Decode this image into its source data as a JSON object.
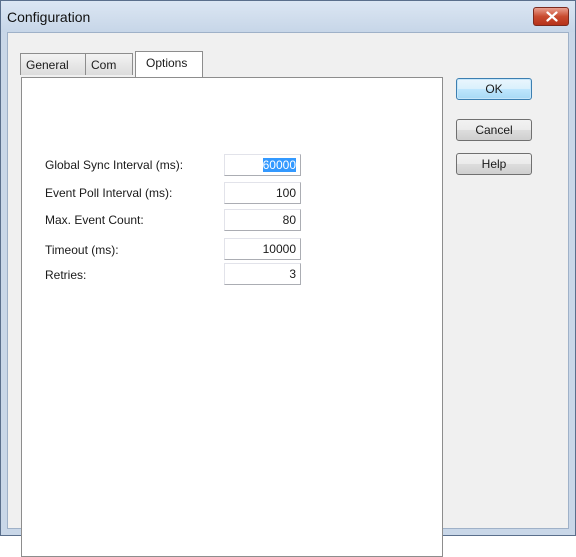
{
  "window": {
    "title": "Configuration"
  },
  "tabs": [
    {
      "label": "General"
    },
    {
      "label": "Com"
    },
    {
      "label": "Options"
    }
  ],
  "active_tab": "Options",
  "fields": [
    {
      "label": "Global Sync Interval (ms):",
      "value": "60000"
    },
    {
      "label": "Event Poll Interval (ms):",
      "value": "100"
    },
    {
      "label": "Max. Event Count:",
      "value": "80"
    },
    {
      "label": "Timeout (ms):",
      "value": "10000"
    },
    {
      "label": "Retries:",
      "value": "3"
    }
  ],
  "buttons": {
    "ok": "OK",
    "cancel": "Cancel",
    "help": "Help"
  },
  "icons": {
    "close": "close-icon"
  }
}
